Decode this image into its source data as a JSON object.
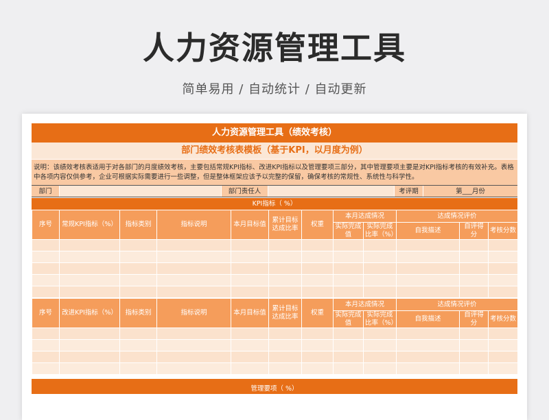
{
  "hero": {
    "title": "人力资源管理工具",
    "subtitle": "简单易用  /  自动统计  /  自动更新"
  },
  "sheet": {
    "title": "人力资源管理工具（绩效考核）",
    "subtitle": "部门绩效考核表模板（基于KPI，以月度为例）",
    "description": "说明：该绩效考核表适用于对各部门的月度绩效考核，主要包括常规KPI指标、改进KPI指标以及管理要项三部分，其中管理要项主要是对KPI指标考核的有效补充。表格中各项内容仅供参考，企业可根据实际需要进行一些调整，但是整体框架应该予以完整的保留，确保考核的常规性、系统性与科学性。",
    "info": {
      "dept_label": "部门",
      "manager_label": "部门责任人",
      "period_label": "考评期",
      "month_label": "第___月份"
    },
    "kpi_bar": "KPI指标（      %）",
    "section1": {
      "no": "序号",
      "indicator": "常规KPI指标（%）",
      "category": "指标类别",
      "explain": "指标说明",
      "target": "本月目标值",
      "cumulative": "累计目标达成比率",
      "weight": "权重",
      "achieve_group": "本月达成情况",
      "actual": "实际完成值",
      "actual_rate": "实际完成比率（%）",
      "eval_group": "达成情况评价",
      "self_desc": "自我描述",
      "self_score": "自评得分",
      "score": "考核分数"
    },
    "section2": {
      "no": "序号",
      "indicator": "改进KPI指标（%）",
      "category": "指标类别",
      "explain": "指标说明",
      "target": "本月目标值",
      "cumulative": "累计目标达成比率",
      "weight": "权重",
      "achieve_group": "本月达成情况",
      "actual": "实际完成值",
      "actual_rate": "实际完成比率（%）",
      "eval_group": "达成情况评价",
      "self_desc": "自我描述",
      "self_score": "自评得分",
      "score": "考核分数"
    },
    "mgmt_bar": "管理要项（      %）"
  },
  "colors": {
    "accent": "#e76e16",
    "header": "#f59d5b",
    "light": "#fbe2cd"
  }
}
